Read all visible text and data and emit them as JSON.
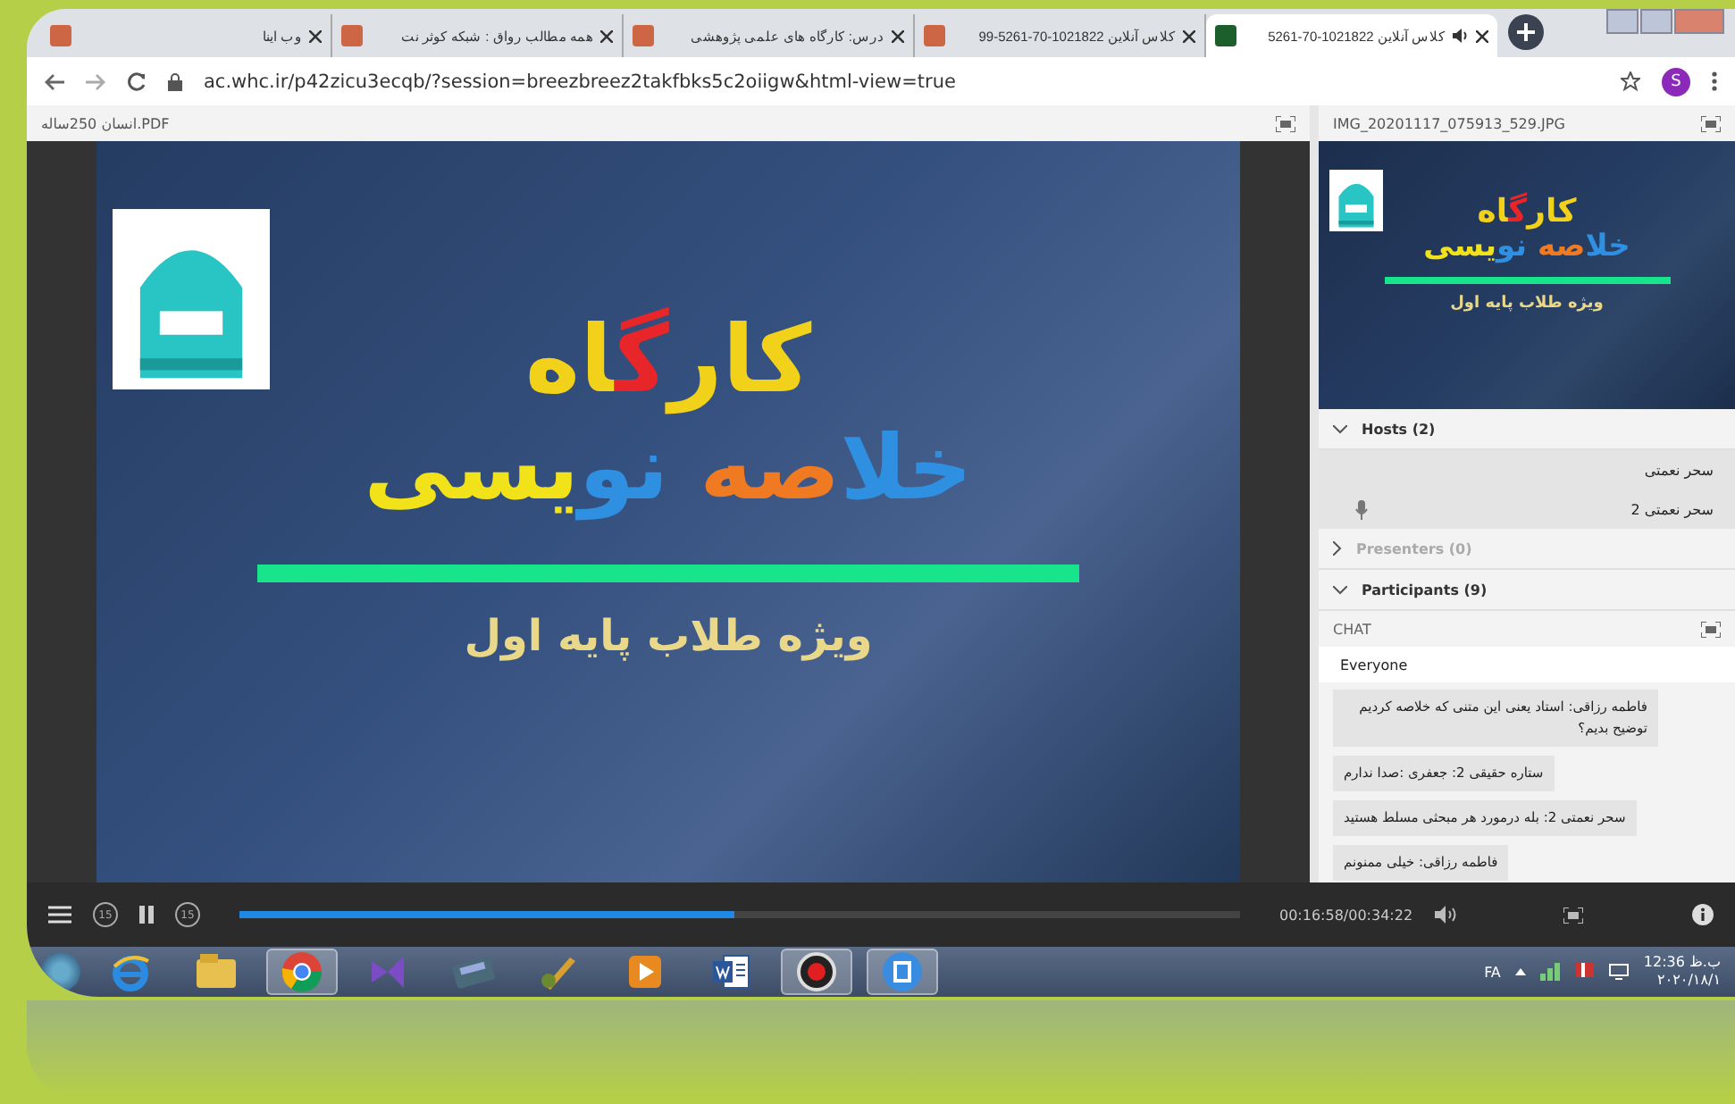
{
  "browser": {
    "tabs": [
      {
        "title": "کلاس آنلاین 1021822-70-5261",
        "selected": true,
        "audio": true
      },
      {
        "title": "کلاس آنلاین 1021822-70-5261-99",
        "selected": false
      },
      {
        "title": "درس: کارگاه های علمی پژوهشی",
        "selected": false
      },
      {
        "title": "همه مطالب رواق : شبکه کوثر نت",
        "selected": false
      },
      {
        "title": "وب اینا",
        "selected": false
      }
    ],
    "url": "ac.whc.ir/p42zicu3ecqb/?session=breezbreez2takfbks5c2oiigw&html-view=true",
    "profile": "S"
  },
  "share_pod": {
    "title": "انسان 250ساله.PDF",
    "slide": {
      "title_parts": [
        {
          "text": "کار",
          "color": "#f2d11a"
        },
        {
          "text": "گ",
          "color": "#e8262a"
        },
        {
          "text": "اه",
          "color": "#f2d11a"
        }
      ],
      "subtitle_parts": [
        {
          "text": "خلا",
          "color": "#2f8fe0"
        },
        {
          "text": "صه",
          "color": "#f07a22"
        },
        {
          "text": " نو",
          "color": "#2f8fe0"
        },
        {
          "text": "یسی",
          "color": "#f2e21a"
        }
      ],
      "caption": "ویژه طلاب پایه اول"
    }
  },
  "image_pod": {
    "title": "IMG_20201117_075913_529.JPG",
    "slide": {
      "title_parts": [
        {
          "text": "کار",
          "color": "#f2d11a"
        },
        {
          "text": "گ",
          "color": "#e8262a"
        },
        {
          "text": "اه",
          "color": "#f2d11a"
        }
      ],
      "subtitle_parts": [
        {
          "text": "خلا",
          "color": "#2f8fe0"
        },
        {
          "text": "صه",
          "color": "#f07a22"
        },
        {
          "text": " نو",
          "color": "#2f8fe0"
        },
        {
          "text": "یسی",
          "color": "#f2e21a"
        }
      ],
      "caption": "ویژه طلاب پایه اول"
    }
  },
  "attendees": [
    {
      "label": "Hosts (2)",
      "expanded": true,
      "disabled": false,
      "members": [
        {
          "name": "سحر نعمتی",
          "mic": false
        },
        {
          "name": "سحر نعمتی 2",
          "mic": true
        }
      ]
    },
    {
      "label": "Presenters (0)",
      "expanded": false,
      "disabled": true
    },
    {
      "label": "Participants (9)",
      "expanded": true,
      "disabled": false
    }
  ],
  "chat": {
    "title": "CHAT",
    "audience": "Everyone",
    "messages": [
      "فاطمه رزاقی: استاد یعنی این متنی که خلاصه کردیم توضیح بدیم؟",
      "ستاره حقیقی 2: جعفری :صدا ندارم",
      "سحر نعمتی 2: بله درمورد هر مبحثی مسلط هستید",
      "فاطمه رزاقی: خیلی ممنونم"
    ]
  },
  "player": {
    "level": 0.494,
    "time": "00:16:58/00:34:22",
    "skip_back": "15",
    "skip_forward": "15"
  },
  "taskbar": {
    "apps": [
      {
        "kind": "ie",
        "selected": false
      },
      {
        "kind": "folder",
        "selected": false
      },
      {
        "kind": "chrome",
        "selected": true
      },
      {
        "kind": "vs",
        "selected": false
      },
      {
        "kind": "scanner",
        "selected": false
      },
      {
        "kind": "brush",
        "selected": false
      },
      {
        "kind": "player",
        "selected": false
      },
      {
        "kind": "word",
        "selected": false
      },
      {
        "kind": "record",
        "selected": true
      },
      {
        "kind": "film",
        "selected": true
      }
    ],
    "language": "FA",
    "time": "12:36 ب.ظ",
    "date": "۲۰۲۰/۱۸/۱"
  }
}
